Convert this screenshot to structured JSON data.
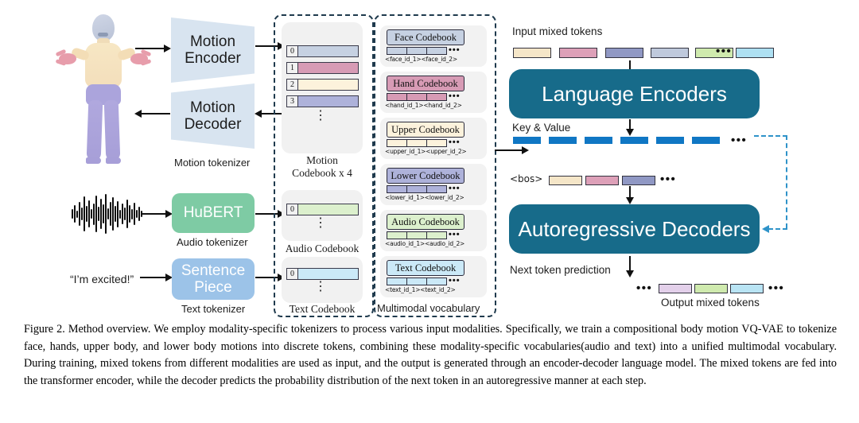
{
  "figure": {
    "motion_tokenizer": {
      "encoder_label": "Motion\nEncoder",
      "decoder_label": "Motion\nDecoder",
      "caption": "Motion tokenizer"
    },
    "audio_tokenizer": {
      "model_label": "HuBERT",
      "caption": "Audio tokenizer"
    },
    "text_tokenizer": {
      "input_text": "“I’m excited!”",
      "model_label": "Sentence\nPiece",
      "caption": "Text tokenizer"
    },
    "codebooks": {
      "motion": {
        "caption_line1": "Motion",
        "caption_line2": "Codebook x 4",
        "rows": [
          {
            "index": "0",
            "color": "#c6d1e2"
          },
          {
            "index": "1",
            "color": "#d79bb5"
          },
          {
            "index": "2",
            "color": "#fcf2dc"
          },
          {
            "index": "3",
            "color": "#aeb2da"
          }
        ],
        "ellipsis": "⋮"
      },
      "audio": {
        "caption": "Audio Codebook",
        "rows": [
          {
            "index": "0",
            "color": "#dcf0cd"
          }
        ]
      },
      "text": {
        "caption": "Text Codebook",
        "rows": [
          {
            "index": "0",
            "color": "#cbe9f7"
          }
        ]
      }
    },
    "vocabulary": {
      "caption": "Multimodal vocabulary",
      "ellipsis": "•••",
      "entries": [
        {
          "title": "Face Codebook",
          "color": "#c6d1e2",
          "ids": "<face_id_1><face_id_2>"
        },
        {
          "title": "Hand Codebook",
          "color": "#d79bb5",
          "ids": "<hand_id_1><hand_id_2>"
        },
        {
          "title": "Upper Codebook",
          "color": "#fcf2dc",
          "ids": "<upper_id_1><upper_id_2>"
        },
        {
          "title": "Lower Codebook",
          "color": "#aeb2da",
          "ids": "<lower_id_1><lower_id_2>"
        },
        {
          "title": "Audio Codebook",
          "color": "#dcf0cd",
          "ids": "<audio_id_1><audio_id_2>"
        },
        {
          "title": "Text Codebook",
          "color": "#cbe9f7",
          "ids": "<text_id_1><text_id_2>"
        }
      ]
    },
    "pipeline": {
      "input_label": "Input mixed tokens",
      "input_tokens": [
        "#f5e6c8",
        "#dda0b8",
        "#9098c4",
        "#bfc9dc",
        "#cfeaae",
        "#aee0f2"
      ],
      "input_ellipsis": "•••",
      "encoder_label": "Language Encoders",
      "key_value_label": "Key & Value",
      "key_value_color": "#1077c4",
      "key_value_count": 6,
      "key_value_ellipsis": "•••",
      "bos_label": "<bos>",
      "bos_tokens": [
        "#f5e6c8",
        "#dda0b8",
        "#9098c4"
      ],
      "bos_ellipsis": "•••",
      "decoder_label": "Autoregressive Decoders",
      "next_token_label": "Next token prediction",
      "output_ellipsis_left": "•••",
      "output_tokens": [
        "#e3d0ea",
        "#cfeaae",
        "#b9e4f4"
      ],
      "output_ellipsis_right": "•••",
      "output_label": "Output mixed tokens"
    }
  },
  "caption": "Figure 2. Method overview. We employ modality-specific tokenizers to process various input modalities. Specifically, we train a compositional body motion VQ-VAE to tokenize face, hands, upper body, and lower body motions into discrete tokens, combining these modality-specific vocabularies(audio and text) into a unified multimodal vocabulary.  During training, mixed tokens from different modalities are used as input, and the output is generated through an encoder-decoder language model.  The mixed tokens are fed into the transformer encoder, while the decoder predicts the probability distribution of the next token in an autoregressive manner at each step."
}
